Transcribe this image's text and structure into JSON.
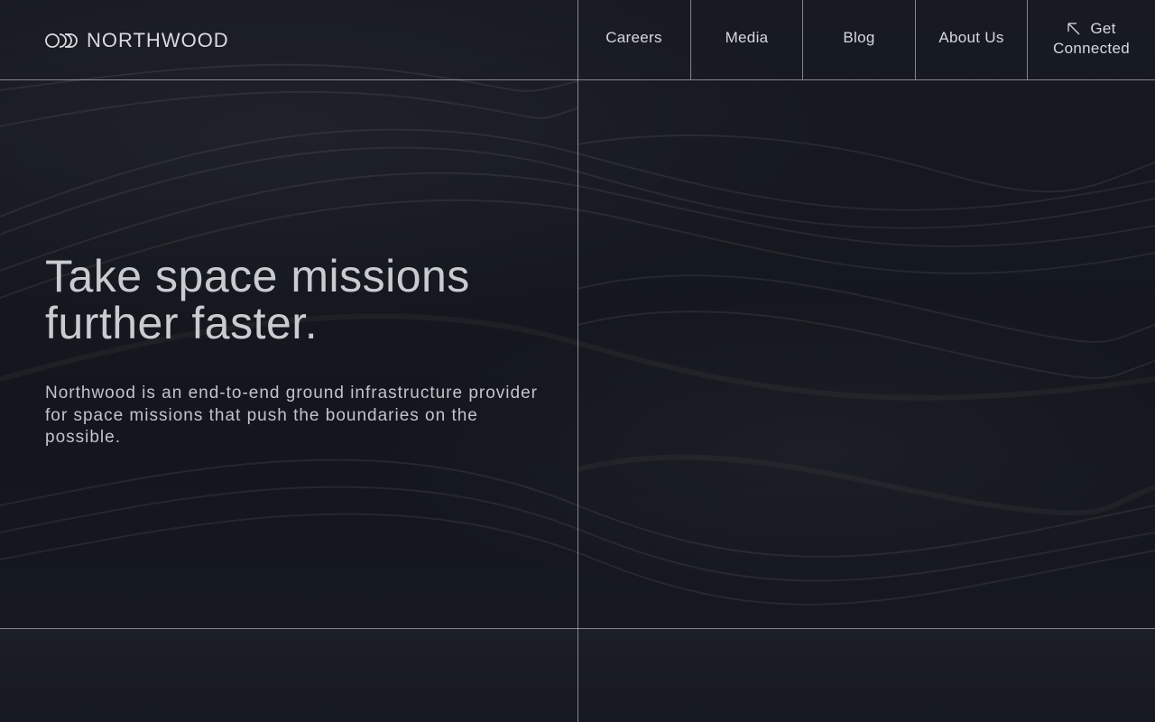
{
  "header": {
    "brand": "NORTHWOOD",
    "nav": [
      {
        "label": "Careers"
      },
      {
        "label": "Media"
      },
      {
        "label": "Blog"
      },
      {
        "label": "About Us"
      }
    ],
    "cta": {
      "line1": "Get",
      "line2": "Connected",
      "icon": "arrow-up-left-icon"
    }
  },
  "hero": {
    "title_line1": "Take space missions",
    "title_line2": "further faster.",
    "description": "Northwood is an end-to-end ground infrastructure provider for space missions that push the boundaries on the possible."
  },
  "colors": {
    "background": "#151820",
    "text": "#d6d8de",
    "lines": "#dcdee4"
  }
}
